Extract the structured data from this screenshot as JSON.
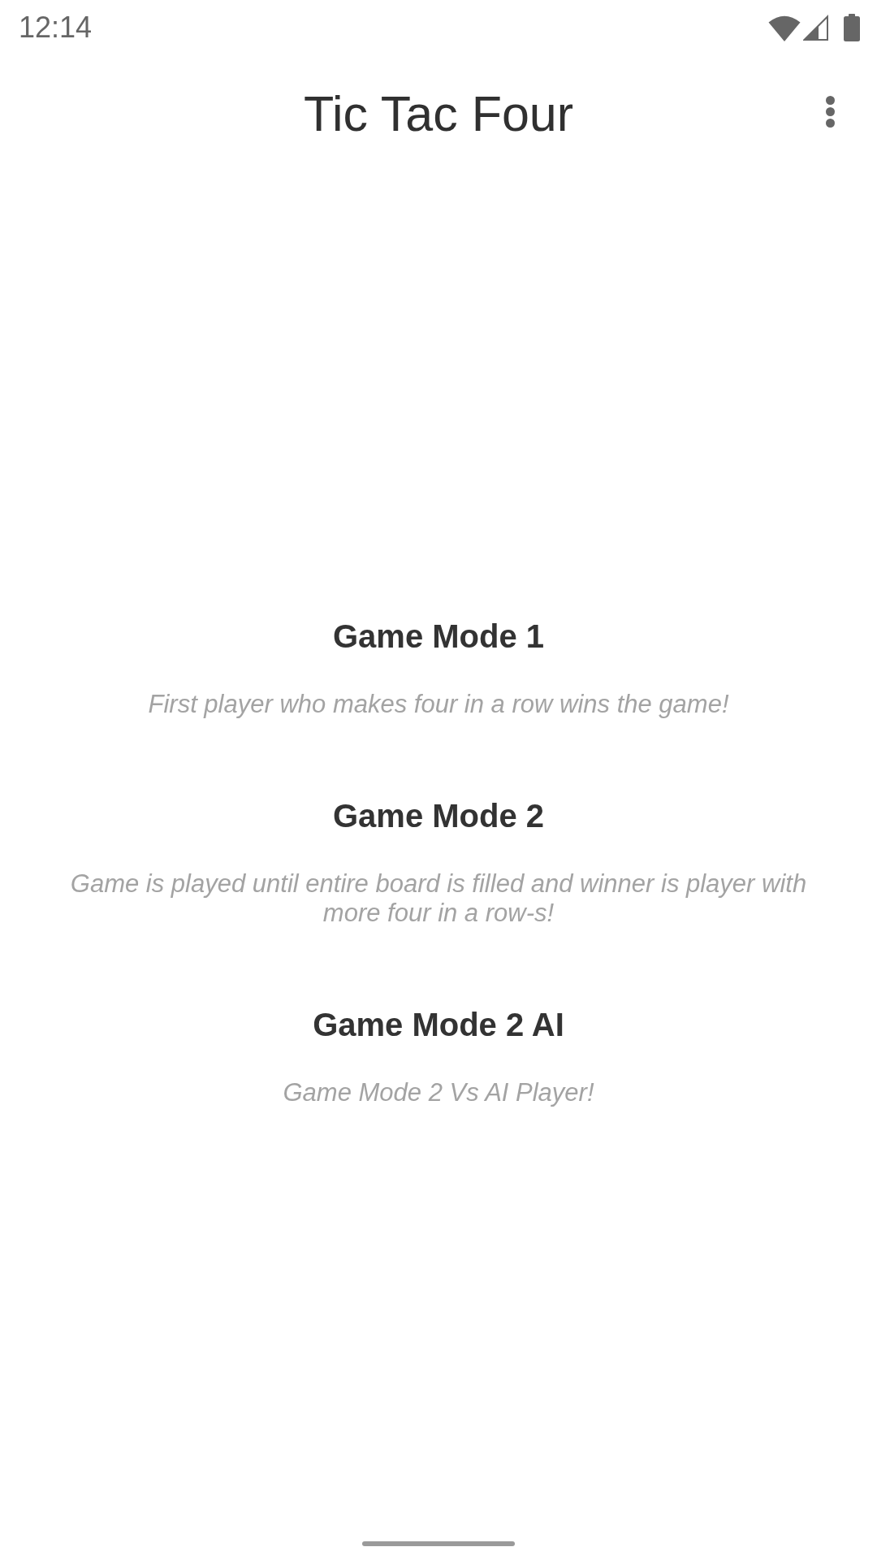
{
  "status_bar": {
    "time": "12:14"
  },
  "app_bar": {
    "title": "Tic Tac Four"
  },
  "game_modes": [
    {
      "title": "Game Mode 1",
      "description": "First player who makes four in a row wins the game!"
    },
    {
      "title": "Game Mode 2",
      "description": "Game is played until entire board is filled and winner is player with more four in a row-s!"
    },
    {
      "title": "Game Mode 2 AI",
      "description": "Game Mode 2 Vs AI Player!"
    }
  ]
}
